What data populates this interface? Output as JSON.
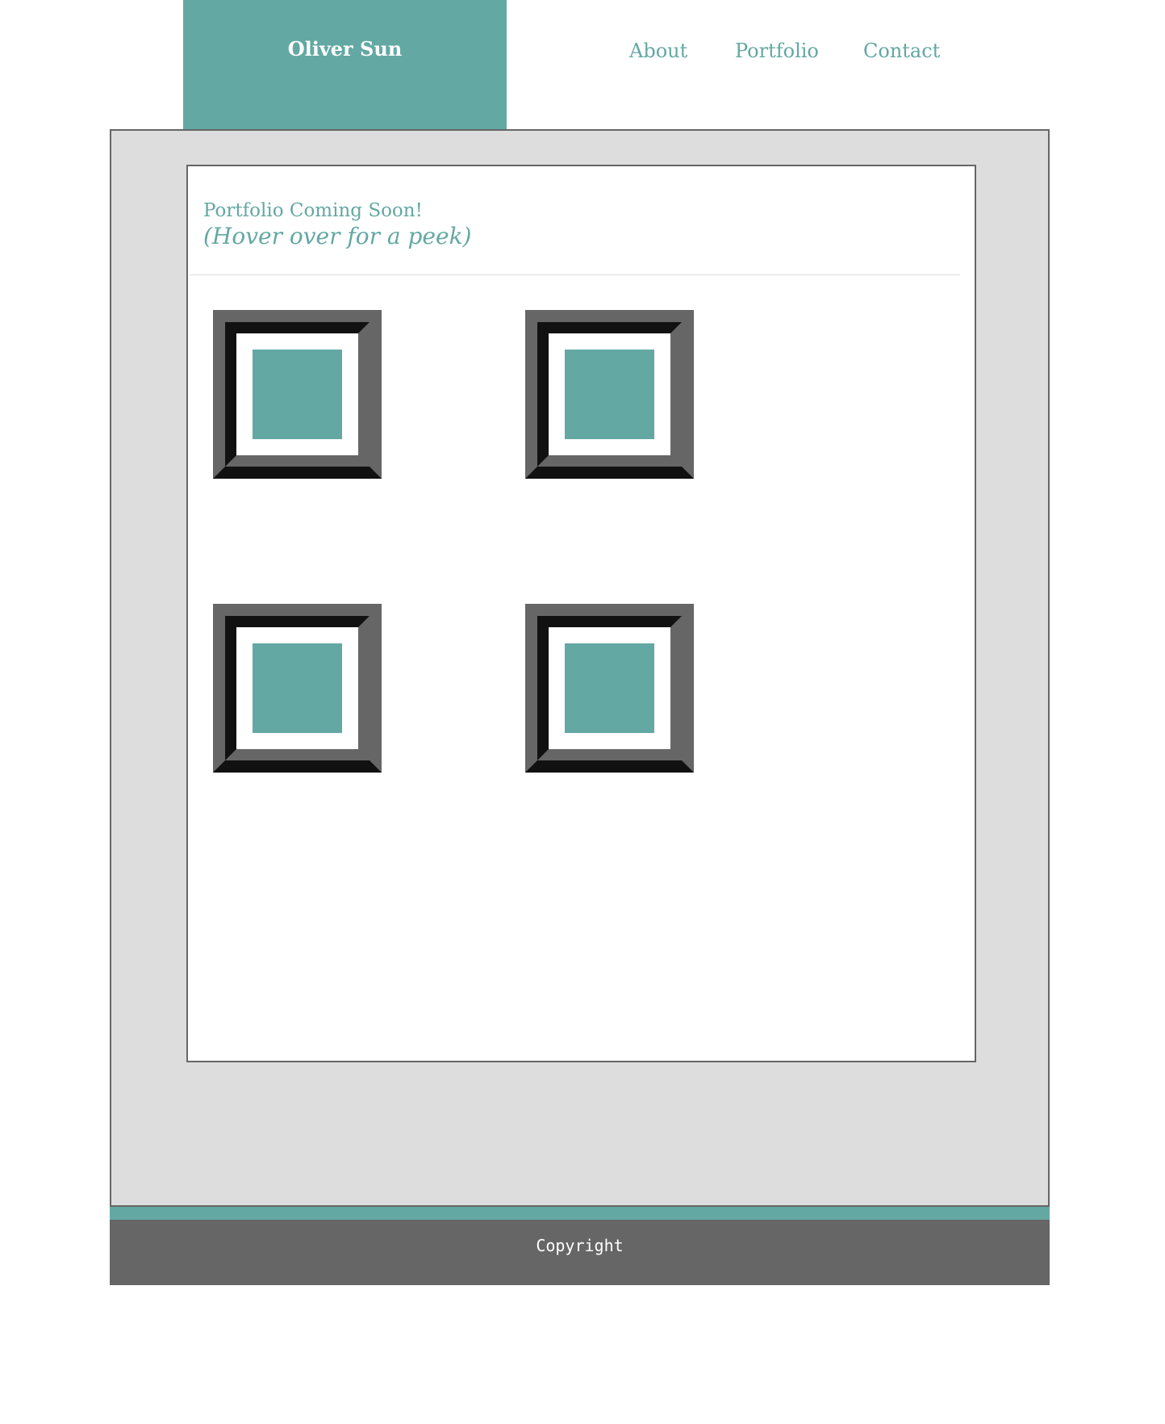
{
  "header": {
    "brand_name": "Oliver Sun",
    "nav": {
      "about": "About",
      "portfolio": "Portfolio",
      "contact": "Contact"
    }
  },
  "main": {
    "heading": "Portfolio Coming Soon!",
    "subheading": "(Hover over for a peek)",
    "frames": [
      {
        "name": "portfolio-frame-1"
      },
      {
        "name": "portfolio-frame-2"
      },
      {
        "name": "portfolio-frame-3"
      },
      {
        "name": "portfolio-frame-4"
      }
    ]
  },
  "footer": {
    "copyright": "Copyright"
  },
  "colors": {
    "accent": "#63a8a3",
    "wrapper_bg": "#dddddd",
    "footer_bg": "#666666",
    "frame_dark": "#111111",
    "frame_mid": "#666666"
  }
}
